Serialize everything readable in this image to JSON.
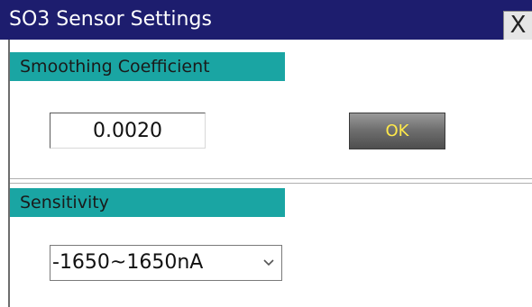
{
  "window": {
    "title": "SO3 Sensor Settings",
    "close_label": "X"
  },
  "smoothing": {
    "header": "Smoothing Coefficient",
    "value": "0.0020",
    "ok_label": "OK"
  },
  "sensitivity": {
    "header": "Sensitivity",
    "selected": "-1650~1650nA"
  },
  "colors": {
    "title_bar": "#1d1d6e",
    "group_header": "#1aa5a3",
    "ok_text": "#ffe94a"
  },
  "icons": {
    "close": "close-icon",
    "dropdown": "chevron-down-icon"
  }
}
